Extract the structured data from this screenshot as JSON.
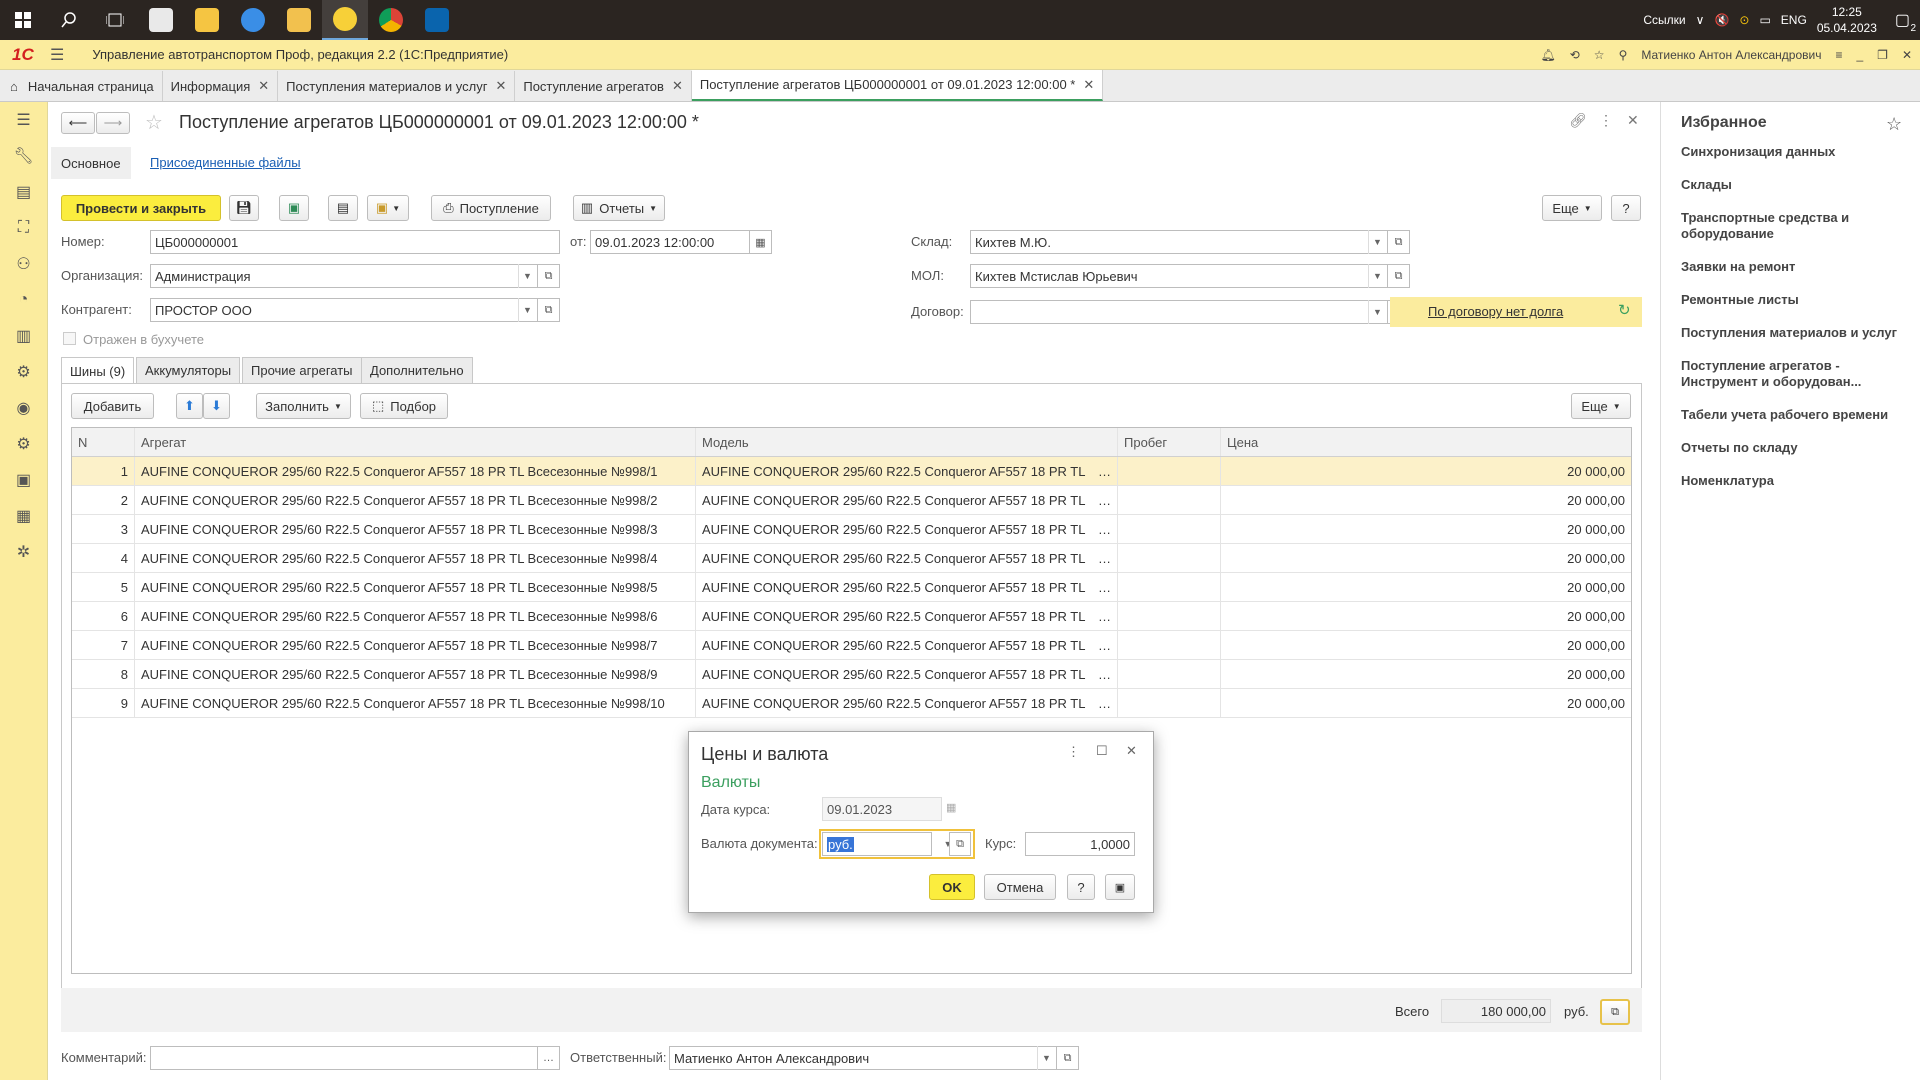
{
  "taskbar": {
    "links_label": "Ссылки",
    "lang": "ENG",
    "time": "12:25",
    "date": "05.04.2023",
    "notif_count": "2"
  },
  "app": {
    "logo": "1С",
    "title": "Управление автотранспортом Проф, редакция 2.2  (1С:Предприятие)",
    "user": "Матиенко Антон Александрович"
  },
  "tabs": [
    {
      "label": "Начальная страница",
      "closable": false
    },
    {
      "label": "Информация",
      "closable": true
    },
    {
      "label": "Поступления материалов и услуг",
      "closable": true
    },
    {
      "label": "Поступление агрегатов",
      "closable": true
    },
    {
      "label": "Поступление агрегатов ЦБ000000001 от 09.01.2023 12:00:00 *",
      "closable": true,
      "active": true
    }
  ],
  "form": {
    "title": "Поступление агрегатов ЦБ000000001 от 09.01.2023 12:00:00 *",
    "nav_main": "Основное",
    "nav_files": "Присоединенные файлы",
    "toolbar": {
      "post_close": "Провести и закрыть",
      "receipt": "Поступление",
      "reports": "Отчеты",
      "more": "Еще",
      "help": "?"
    },
    "fields": {
      "number_label": "Номер:",
      "number": "ЦБ000000001",
      "from_label": "от:",
      "date": "09.01.2023 12:00:00",
      "org_label": "Организация:",
      "org": "Администрация",
      "contractor_label": "Контрагент:",
      "contractor": "ПРОСТОР ООО",
      "accounting_label": "Отражен в бухучете",
      "warehouse_label": "Склад:",
      "warehouse": "Кихтев М.Ю.",
      "mol_label": "МОЛ:",
      "mol": "Кихтев Мстислав Юрьевич",
      "contract_label": "Договор:",
      "contract": "",
      "debt_label": "По договору нет долга"
    },
    "inner_tabs": [
      "Шины (9)",
      "Аккумуляторы",
      "Прочие агрегаты",
      "Дополнительно"
    ],
    "grid_toolbar": {
      "add": "Добавить",
      "fill": "Заполнить",
      "pick": "Подбор",
      "more": "Еще"
    },
    "grid": {
      "columns": [
        "N",
        "Агрегат",
        "Модель",
        "Пробег",
        "Цена"
      ],
      "rows": [
        {
          "n": "1",
          "unit": "AUFINE CONQUEROR 295/60 R22.5 Conqueror AF557 18 PR TL   Всесезонные №998/1",
          "model": "AUFINE CONQUEROR 295/60 R22.5 Conqueror AF557 18 PR TL",
          "mileage": "",
          "price": "20 000,00"
        },
        {
          "n": "2",
          "unit": "AUFINE CONQUEROR 295/60 R22.5 Conqueror AF557 18 PR TL   Всесезонные №998/2",
          "model": "AUFINE CONQUEROR 295/60 R22.5 Conqueror AF557 18 PR TL",
          "mileage": "",
          "price": "20 000,00"
        },
        {
          "n": "3",
          "unit": "AUFINE CONQUEROR 295/60 R22.5 Conqueror AF557 18 PR TL   Всесезонные №998/3",
          "model": "AUFINE CONQUEROR 295/60 R22.5 Conqueror AF557 18 PR TL",
          "mileage": "",
          "price": "20 000,00"
        },
        {
          "n": "4",
          "unit": "AUFINE CONQUEROR 295/60 R22.5 Conqueror AF557 18 PR TL   Всесезонные №998/4",
          "model": "AUFINE CONQUEROR 295/60 R22.5 Conqueror AF557 18 PR TL",
          "mileage": "",
          "price": "20 000,00"
        },
        {
          "n": "5",
          "unit": "AUFINE CONQUEROR 295/60 R22.5 Conqueror AF557 18 PR TL   Всесезонные №998/5",
          "model": "AUFINE CONQUEROR 295/60 R22.5 Conqueror AF557 18 PR TL",
          "mileage": "",
          "price": "20 000,00"
        },
        {
          "n": "6",
          "unit": "AUFINE CONQUEROR 295/60 R22.5 Conqueror AF557 18 PR TL   Всесезонные №998/6",
          "model": "AUFINE CONQUEROR 295/60 R22.5 Conqueror AF557 18 PR TL",
          "mileage": "",
          "price": "20 000,00"
        },
        {
          "n": "7",
          "unit": "AUFINE CONQUEROR 295/60 R22.5 Conqueror AF557 18 PR TL   Всесезонные №998/7",
          "model": "AUFINE CONQUEROR 295/60 R22.5 Conqueror AF557 18 PR TL",
          "mileage": "",
          "price": "20 000,00"
        },
        {
          "n": "8",
          "unit": "AUFINE CONQUEROR 295/60 R22.5 Conqueror AF557 18 PR TL   Всесезонные №998/9",
          "model": "AUFINE CONQUEROR 295/60 R22.5 Conqueror AF557 18 PR TL",
          "mileage": "",
          "price": "20 000,00"
        },
        {
          "n": "9",
          "unit": "AUFINE CONQUEROR 295/60 R22.5 Conqueror AF557 18 PR TL   Всесезонные №998/10",
          "model": "AUFINE CONQUEROR 295/60 R22.5 Conqueror AF557 18 PR TL",
          "mileage": "",
          "price": "20 000,00"
        }
      ]
    },
    "footer": {
      "total_label": "Всего",
      "total": "180 000,00",
      "currency": "руб.",
      "comment_label": "Комментарий:",
      "comment": "",
      "responsible_label": "Ответственный:",
      "responsible": "Матиенко Антон Александрович"
    }
  },
  "dialog": {
    "title": "Цены и валюта",
    "section": "Валюты",
    "rate_date_label": "Дата курса:",
    "rate_date": "09.01.2023",
    "currency_label": "Валюта документа:",
    "currency": "руб.",
    "rate_label": "Курс:",
    "rate": "1,0000",
    "ok": "OK",
    "cancel": "Отмена",
    "help": "?"
  },
  "favorites": {
    "title": "Избранное",
    "items": [
      "Синхронизация данных",
      "Склады",
      "Транспортные средства и оборудование",
      "Заявки на ремонт",
      "Ремонтные листы",
      "Поступления материалов и услуг",
      "Поступление агрегатов - Инструмент и оборудован...",
      "Табели учета рабочего времени",
      "Отчеты по складу",
      "Номенклатура"
    ]
  },
  "colors": {
    "accent_yellow": "#fbec9e",
    "button_yellow": "#fbed3e",
    "active_tab_green": "#3b9f5f",
    "dialog_green": "#3b9f5f",
    "logo_red": "#d31f1f"
  }
}
